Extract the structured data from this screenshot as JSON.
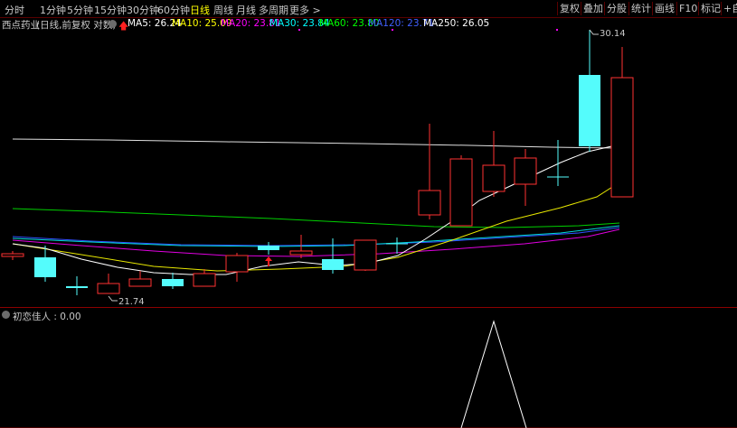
{
  "toolbar": {
    "periods": [
      "分时",
      "1分钟",
      "5分钟",
      "15分钟",
      "30分钟",
      "60分钟",
      "日线",
      "周线",
      "月线",
      "多周期",
      "更多 >"
    ],
    "active_period": "日线",
    "buttons": [
      "复权",
      "叠加",
      "分股",
      "统计",
      "画线",
      "F10",
      "标记",
      "+自"
    ]
  },
  "info": {
    "stock_name": "西点药业",
    "mode": "(日线,前复权 对数)",
    "ma": [
      {
        "label": "MA5: 26.24",
        "color": "#ffffff"
      },
      {
        "label": "MA10: 25.09",
        "color": "#ffff00"
      },
      {
        "label": "MA20: 23.81",
        "color": "#ff00ff"
      },
      {
        "label": "MA30: 23.84",
        "color": "#00ffff"
      },
      {
        "label": "MA60: 23.80",
        "color": "#00ff00"
      },
      {
        "label": "MA120: 23.71",
        "color": "#4060ff"
      },
      {
        "label": "MA250: 26.05",
        "color": "#ffffff"
      }
    ]
  },
  "annotations": {
    "high": "30.14",
    "low": "21.74"
  },
  "indicator": {
    "label": "初恋佳人 : 0.00"
  },
  "colors": {
    "up": "#ff3232",
    "down": "#54fcfc",
    "grid": "#8b0000"
  }
}
